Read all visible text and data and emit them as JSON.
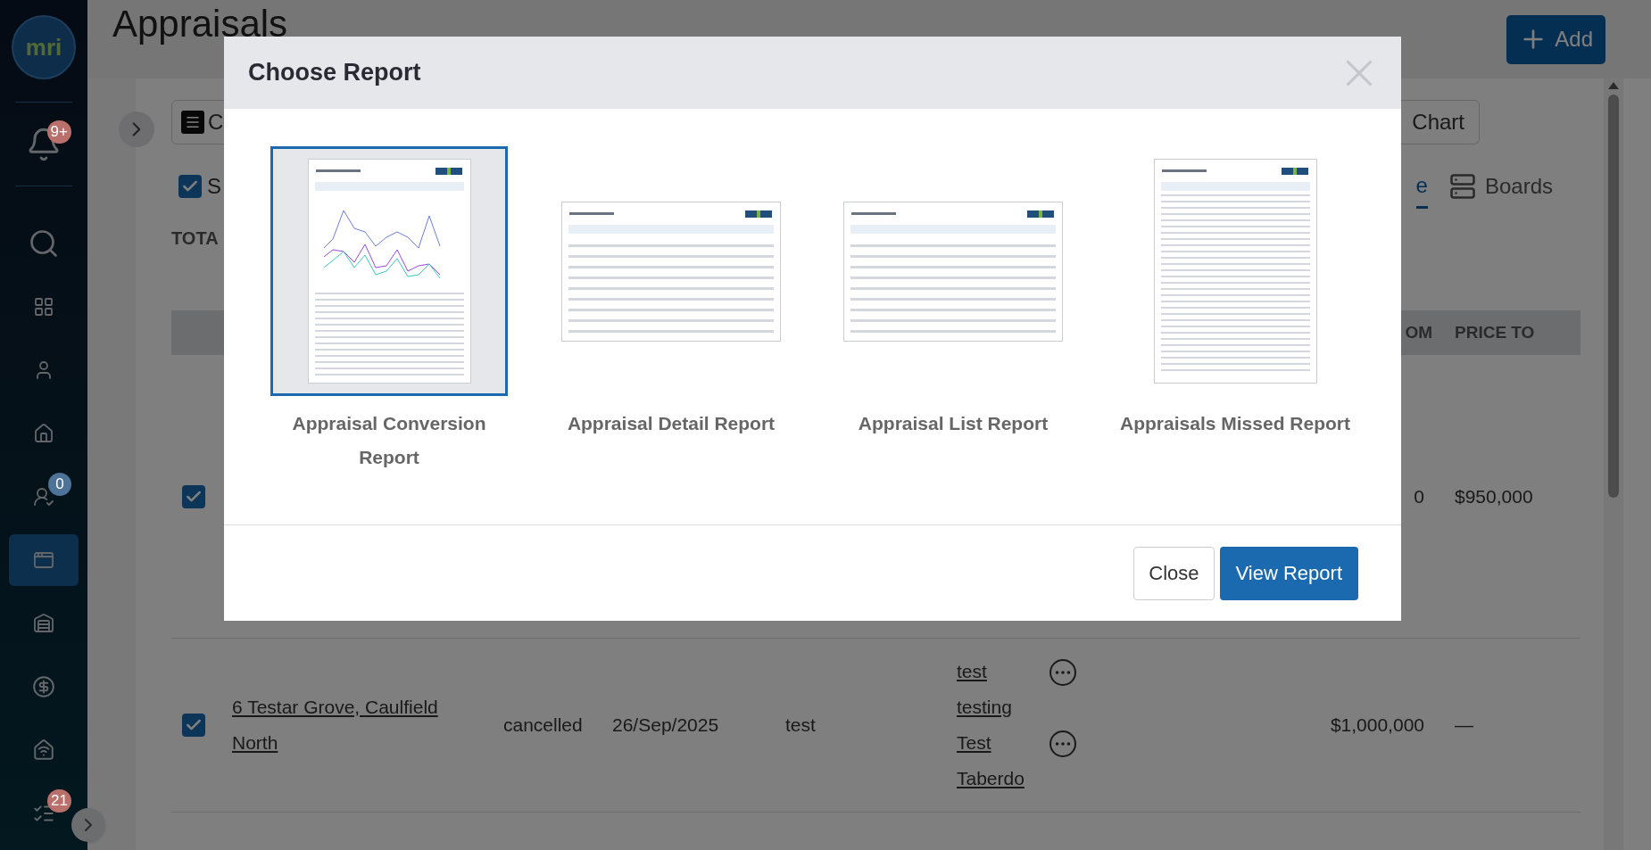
{
  "sidebar": {
    "logo": "mri",
    "items": [
      {
        "selected": false,
        "badge": "9+",
        "color": "#b9706b"
      },
      {
        "selected": false
      },
      {
        "selected": false
      },
      {
        "selected": false
      },
      {
        "selected": false
      },
      {
        "selected": false,
        "badge": "0",
        "color": "#4d7399"
      },
      {
        "selected": true
      },
      {
        "selected": false
      },
      {
        "selected": false
      },
      {
        "selected": false
      },
      {
        "selected": false,
        "badge": "21",
        "color": "#b9706b"
      }
    ]
  },
  "page": {
    "title": "Appraisals",
    "add_button": "Add"
  },
  "toolbar": {
    "menu_button": "C",
    "chart_button": "Chart",
    "select_all": {
      "label": "S",
      "checked": true
    }
  },
  "tabs": [
    {
      "label": "e",
      "selected": true
    },
    {
      "label": "Boards",
      "selected": false
    }
  ],
  "totals_label": "TOTA",
  "table": {
    "columns": [
      "OM",
      "PRICE TO"
    ],
    "rows": [
      {
        "checked": true,
        "price_from": "0",
        "price_to": "$950,000"
      },
      {
        "checked": true,
        "address": "6 Testar Grove, Caulfield North",
        "status": "cancelled",
        "date": "26/Sep/2025",
        "consultant": "test",
        "contacts": [
          "test testing",
          "Test Taberdo"
        ],
        "price_from": "$1,000,000",
        "price_to": "—"
      }
    ]
  },
  "modal": {
    "title": "Choose Report",
    "reports": [
      {
        "label": "Appraisal Conversion Report",
        "selected": true,
        "kind": "chart"
      },
      {
        "label": "Appraisal Detail Report",
        "selected": false,
        "kind": "wide"
      },
      {
        "label": "Appraisal List Report",
        "selected": false,
        "kind": "wide"
      },
      {
        "label": "Appraisals Missed Report",
        "selected": false,
        "kind": "tall"
      }
    ],
    "close_button": "Close",
    "primary_button": "View Report"
  }
}
